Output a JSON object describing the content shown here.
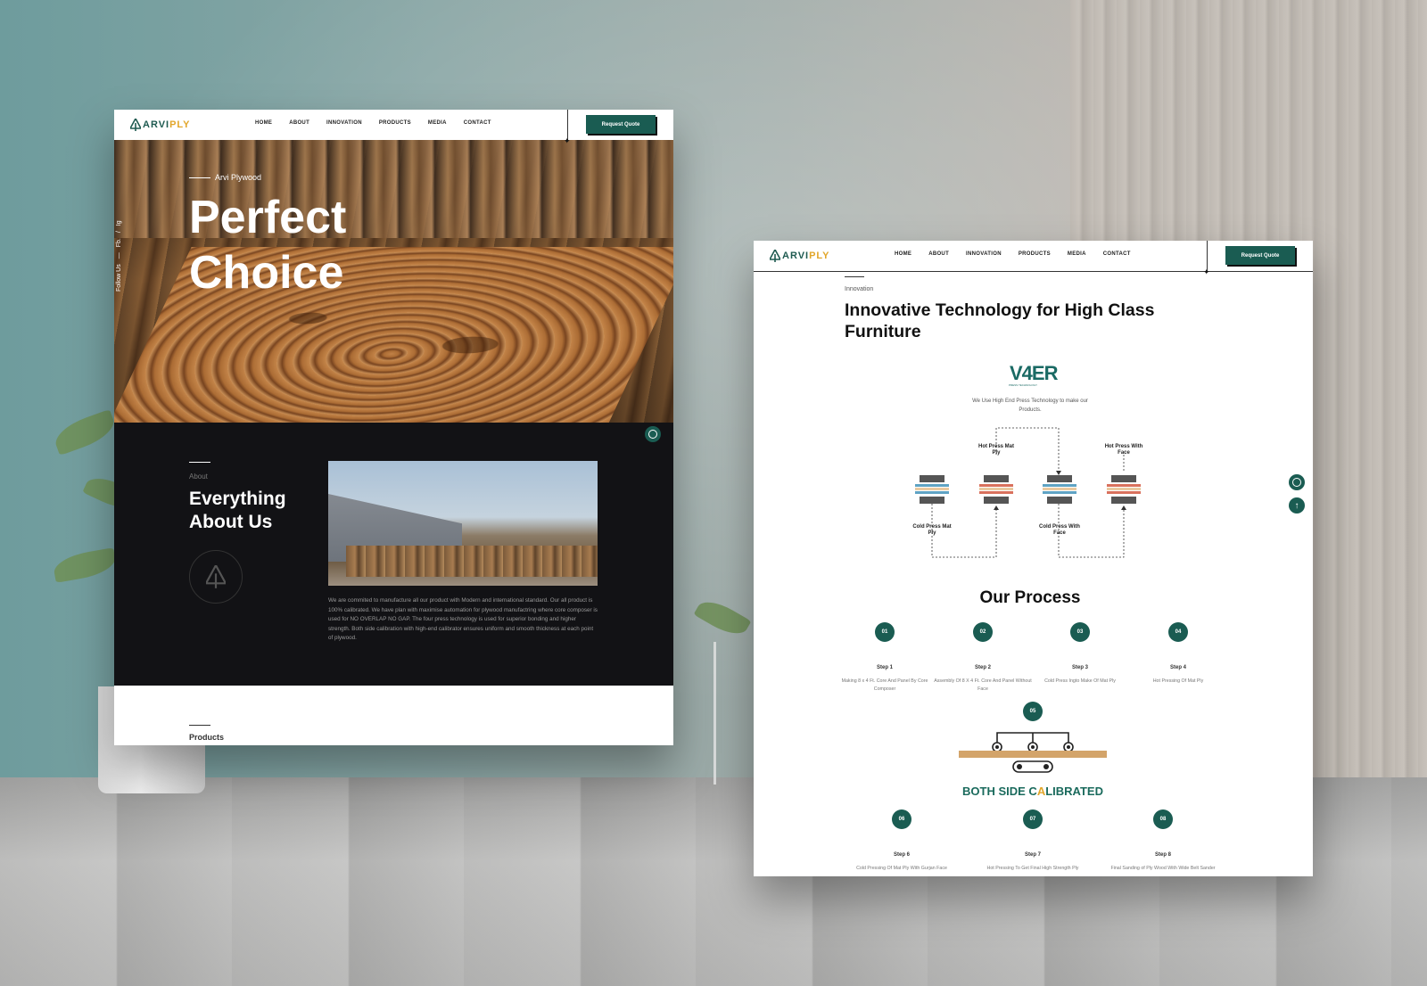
{
  "brand": {
    "logo_main": "ARVI",
    "logo_accent": "PLY"
  },
  "nav": {
    "links": [
      "HOME",
      "ABOUT",
      "INNOVATION",
      "PRODUCTS",
      "MEDIA",
      "CONTACT"
    ],
    "cta": "Request Quote"
  },
  "hero": {
    "eyebrow": "Arvi Plywood",
    "title": "Perfect Choice",
    "follow": {
      "label": "Follow Us",
      "dash": "—",
      "fb": "Fb.",
      "slash": "/",
      "ig": "Ig"
    }
  },
  "about": {
    "eyebrow": "About",
    "title": "Everything About Us",
    "text": "We are commited to manufacture all our product with Modern and international standard. Our all product is 100% calibrated. We have plan with maximise automation for plywood manufactring where core composer is used for NO OVERLAP NO GAP. The four press technology is used for superior bonding and higher strength. Both side calibration with high-end calibrator ensures uniform and smooth thickness at each point of plywood."
  },
  "products": {
    "eyebrow": "Products"
  },
  "innovation": {
    "eyebrow": "Innovation",
    "title": "Innovative Technology for High Class Furniture",
    "tech_logo": "V4ER",
    "tech_logo_sub": "PRESS TECHNOLOGY",
    "tech_text": "We Use High End Press Technology to make our Products.",
    "press_labels": {
      "hot_mat": "Hot Press Mat Ply",
      "hot_face": "Hot Press With Face",
      "cold_mat": "Cold Press Mat Ply",
      "cold_face": "Cold Press With Face"
    }
  },
  "process": {
    "title": "Our Process",
    "steps": [
      {
        "num": "01",
        "title": "Step 1",
        "desc": "Making 8 x 4 Ft. Core And Panel By Core Composer"
      },
      {
        "num": "02",
        "title": "Step 2",
        "desc": "Assembly Of 8 X 4 Ft. Core And Panel Without Face"
      },
      {
        "num": "03",
        "title": "Step 3",
        "desc": "Cold Press Ingto Make Of Mat Ply"
      },
      {
        "num": "04",
        "title": "Step 4",
        "desc": "Hot Pressing Of Mat Ply"
      },
      {
        "num": "05"
      },
      {
        "num": "06",
        "title": "Step 6",
        "desc": "Cold Pressing Of Mat Ply With Gurjan Face"
      },
      {
        "num": "07",
        "title": "Step 7",
        "desc": "Hot Pressing To Get Final High Strength Ply"
      },
      {
        "num": "08",
        "title": "Step 8",
        "desc": "Final Sanding of Ply Wood With Wide Belt Sander"
      }
    ],
    "calibrated_a": "BOTH SIDE C",
    "calibrated_b": "A",
    "calibrated_c": "LIBRATED"
  },
  "colors": {
    "brand_green": "#1a5c52",
    "accent_gold": "#e2a62a",
    "dark_bg": "#121215"
  }
}
